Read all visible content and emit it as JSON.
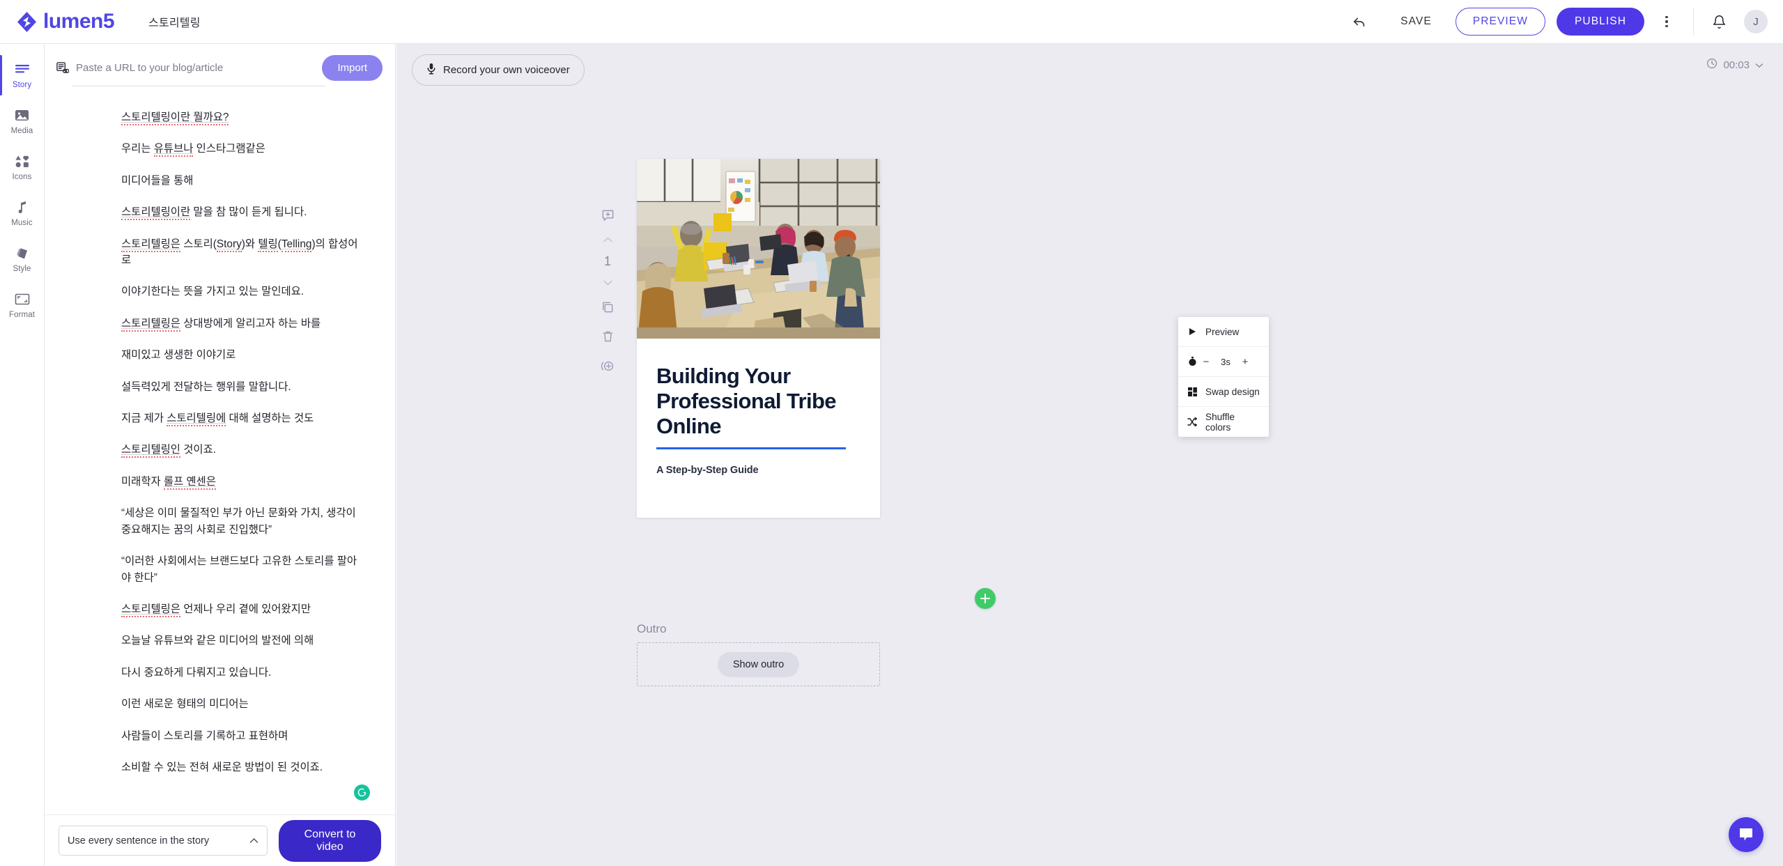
{
  "app": {
    "brand": "lumen5",
    "project_title": "스토리텔링",
    "accent": "#4f46e5",
    "publish_color": "#4f38e8",
    "canvas_bg": "#ebebf1"
  },
  "topbar": {
    "undo_icon": "undo-icon",
    "save_label": "SAVE",
    "preview_label": "PREVIEW",
    "publish_label": "PUBLISH",
    "more_icon": "kebab-menu-icon",
    "bell_icon": "notification-bell-icon",
    "avatar_initial": "J"
  },
  "rail": {
    "items": [
      {
        "label": "Story",
        "icon": "story-lines-icon",
        "active": true
      },
      {
        "label": "Media",
        "icon": "image-icon",
        "active": false
      },
      {
        "label": "Icons",
        "icon": "shapes-icon",
        "active": false
      },
      {
        "label": "Music",
        "icon": "music-note-icon",
        "active": false
      },
      {
        "label": "Style",
        "icon": "palette-icon",
        "active": false
      },
      {
        "label": "Format",
        "icon": "aspect-ratio-icon",
        "active": false
      }
    ]
  },
  "story": {
    "url_icon": "link-article-icon",
    "url_placeholder": "Paste a URL to your blog/article",
    "url_value": "",
    "import_label": "Import",
    "grammarly_icon": "grammarly-icon",
    "paragraphs": [
      {
        "parts": [
          {
            "t": "스토리텔링이란 뭘까요?",
            "sp": true
          }
        ]
      },
      {
        "parts": [
          {
            "t": "우리는 ",
            "sp": false
          },
          {
            "t": "유튜브나",
            "sp": true
          },
          {
            "t": " 인스타그램같은",
            "sp": false
          }
        ]
      },
      {
        "parts": [
          {
            "t": "미디어들을 통해",
            "sp": false
          }
        ]
      },
      {
        "parts": [
          {
            "t": "스토리텔링이란",
            "sp": true
          },
          {
            "t": " 말을 참 많이 듣게 됩니다.",
            "sp": false
          }
        ]
      },
      {
        "parts": [
          {
            "t": "스토리텔링은",
            "sp": true
          },
          {
            "t": " 스토리(",
            "sp": false
          },
          {
            "t": "Story",
            "sp": true
          },
          {
            "t": ")와 ",
            "sp": false
          },
          {
            "t": "텔링",
            "sp": true
          },
          {
            "t": "(",
            "sp": false
          },
          {
            "t": "Telling",
            "sp": true
          },
          {
            "t": ")의 합성어로",
            "sp": false
          }
        ]
      },
      {
        "parts": [
          {
            "t": "이야기한다는 뜻을 가지고 있는 말인데요.",
            "sp": false
          }
        ]
      },
      {
        "parts": [
          {
            "t": "스토리텔링은",
            "sp": true
          },
          {
            "t": " 상대방에게 알리고자 하는 바를",
            "sp": false
          }
        ]
      },
      {
        "parts": [
          {
            "t": "재미있고 생생한 이야기로",
            "sp": false
          }
        ]
      },
      {
        "parts": [
          {
            "t": "설득력있게 전달하는 행위를 말합니다.",
            "sp": false
          }
        ]
      },
      {
        "parts": [
          {
            "t": "지금 제가 ",
            "sp": false
          },
          {
            "t": "스토리텔링에",
            "sp": true
          },
          {
            "t": " 대해 설명하는 것도",
            "sp": false
          }
        ]
      },
      {
        "parts": [
          {
            "t": "스토리텔링인",
            "sp": true
          },
          {
            "t": " 것이죠.",
            "sp": false
          }
        ]
      },
      {
        "parts": [
          {
            "t": "미래학자 ",
            "sp": false
          },
          {
            "t": "롤프 옌센은",
            "sp": true
          }
        ]
      },
      {
        "parts": [
          {
            "t": "“세상은 이미 물질적인 부가 아닌 문화와 가치, 생각이 중요해지는 꿈의 사회로 진입했다”",
            "sp": false
          }
        ]
      },
      {
        "parts": [
          {
            "t": "“이러한 사회에서는 브랜드보다 고유한 스토리를 팔아야 한다”",
            "sp": false
          }
        ]
      },
      {
        "parts": [
          {
            "t": "스토리텔링은",
            "sp": true
          },
          {
            "t": " 언제나 우리 곁에 있어왔지만",
            "sp": false
          }
        ]
      },
      {
        "parts": [
          {
            "t": "오늘날 유튜브와 같은 미디어의 발전에 의해",
            "sp": false
          }
        ]
      },
      {
        "parts": [
          {
            "t": "다시 중요하게 다뤄지고 있습니다.",
            "sp": false
          }
        ]
      },
      {
        "parts": [
          {
            "t": "이런 새로운 형태의 미디어는",
            "sp": false
          }
        ]
      },
      {
        "parts": [
          {
            "t": "사람들이 스토리를 기록하고 표현하며",
            "sp": false
          }
        ]
      },
      {
        "parts": [
          {
            "t": "소비할 수 있는 전혀 새로운 방법이 된 것이죠.",
            "sp": false
          }
        ]
      }
    ],
    "footer": {
      "sentence_option": "Use every sentence in the story",
      "caret_icon": "chevron-up-icon",
      "convert_label": "Convert to video"
    }
  },
  "canvas": {
    "voiceover_label": "Record your own voiceover",
    "voiceover_icon": "microphone-icon",
    "timer_icon": "clock-icon",
    "timer_value": "00:03",
    "timer_caret": "chevron-down-icon",
    "scene_tools": {
      "add_comment_icon": "add-comment-icon",
      "move_up_icon": "chevron-up-icon",
      "scene_number": "1",
      "move_down_icon": "chevron-down-icon",
      "duplicate_icon": "duplicate-icon",
      "delete_icon": "trash-icon",
      "record_icon": "record-voice-icon"
    },
    "scene": {
      "photo_alt": "team-meeting-photo",
      "title": "Building Your Professional Tribe Online",
      "rule_color": "#2563eb",
      "subtitle": "A Step-by-Step Guide"
    },
    "add_scene_icon": "add-scene-plus-icon",
    "outro": {
      "label": "Outro",
      "show_label": "Show outro"
    },
    "context_menu": {
      "preview": {
        "label": "Preview",
        "icon": "play-icon"
      },
      "duration": {
        "icon": "stopwatch-icon",
        "minus": "−",
        "value": "3s",
        "plus": "+"
      },
      "swap_design": {
        "label": "Swap design",
        "icon": "grid-squares-icon"
      },
      "shuffle_colors": {
        "label": "Shuffle colors",
        "icon": "shuffle-icon"
      }
    },
    "chat_icon": "chat-bubble-icon"
  }
}
